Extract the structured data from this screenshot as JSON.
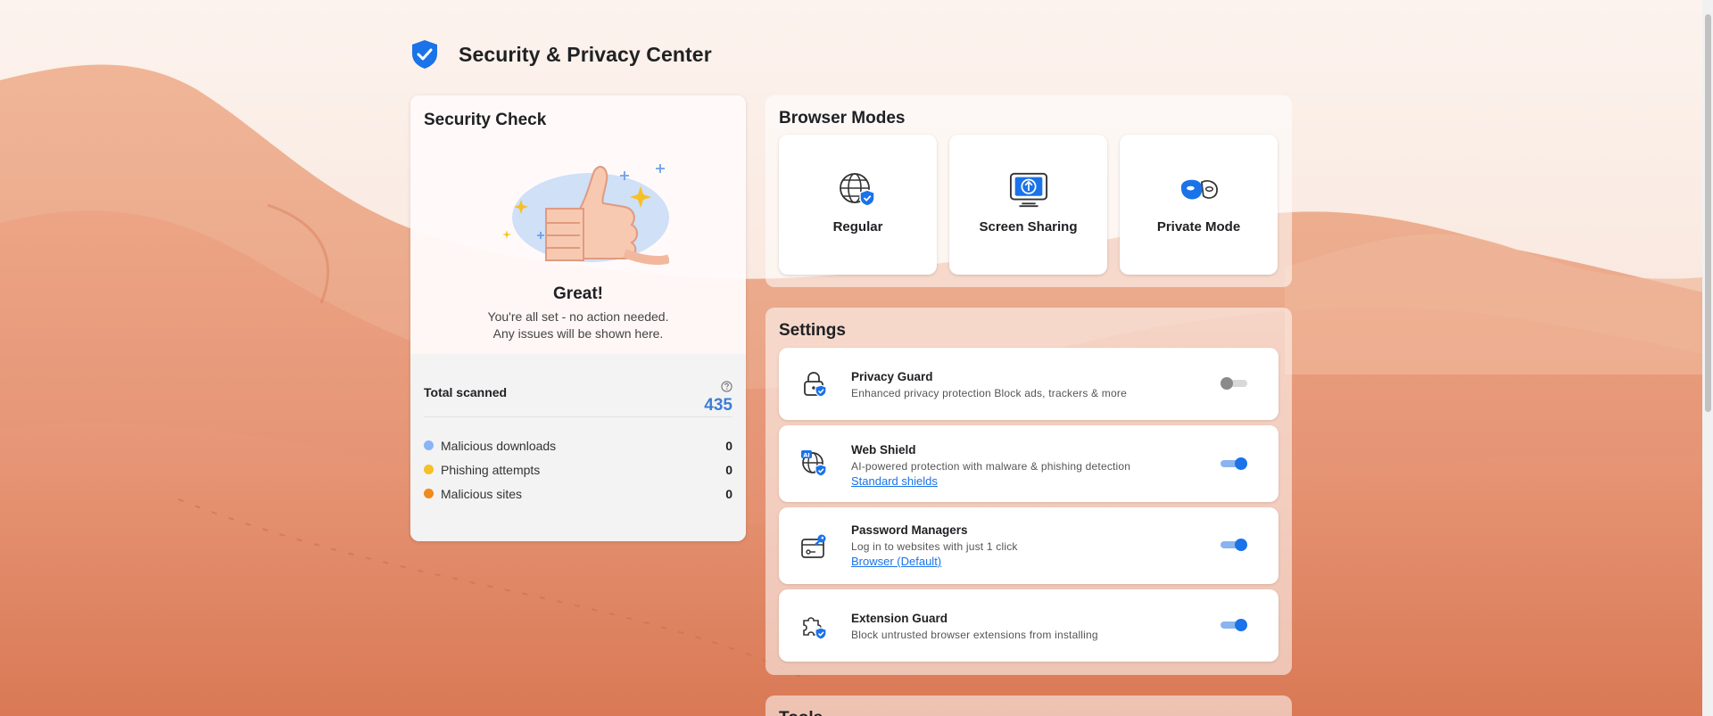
{
  "header": {
    "title": "Security & Privacy Center",
    "icon": "shield-check-icon"
  },
  "security_check": {
    "title": "Security Check",
    "status_title": "Great!",
    "status_line1": "You're all set - no action needed.",
    "status_line2": "Any issues will be shown here.",
    "total_label": "Total scanned",
    "total_value": "435",
    "stats": [
      {
        "label": "Malicious downloads",
        "value": "0",
        "color": "#8ab4f8"
      },
      {
        "label": "Phishing attempts",
        "value": "0",
        "color": "#f6c026"
      },
      {
        "label": "Malicious sites",
        "value": "0",
        "color": "#f08a1c"
      }
    ]
  },
  "browser_modes": {
    "title": "Browser Modes",
    "modes": [
      {
        "label": "Regular",
        "icon": "globe-shield-icon"
      },
      {
        "label": "Screen Sharing",
        "icon": "screen-share-icon"
      },
      {
        "label": "Private Mode",
        "icon": "mask-icon"
      }
    ]
  },
  "settings": {
    "title": "Settings",
    "items": [
      {
        "title": "Privacy Guard",
        "desc": "Enhanced privacy protection Block ads, trackers & more",
        "link": "",
        "enabled": false,
        "icon": "lock-shield-icon"
      },
      {
        "title": "Web Shield",
        "desc": "AI-powered protection with malware & phishing detection",
        "link": "Standard shields",
        "enabled": true,
        "icon": "ai-globe-shield-icon"
      },
      {
        "title": "Password Managers",
        "desc": "Log in to websites with just 1 click",
        "link": "Browser (Default)",
        "enabled": true,
        "icon": "key-card-icon"
      },
      {
        "title": "Extension Guard",
        "desc": "Block untrusted browser extensions from installing",
        "link": "",
        "enabled": true,
        "icon": "puzzle-shield-icon"
      }
    ]
  },
  "tools": {
    "title": "Tools"
  },
  "colors": {
    "accent": "#1a73e8",
    "total_value": "#3c7ed6"
  }
}
